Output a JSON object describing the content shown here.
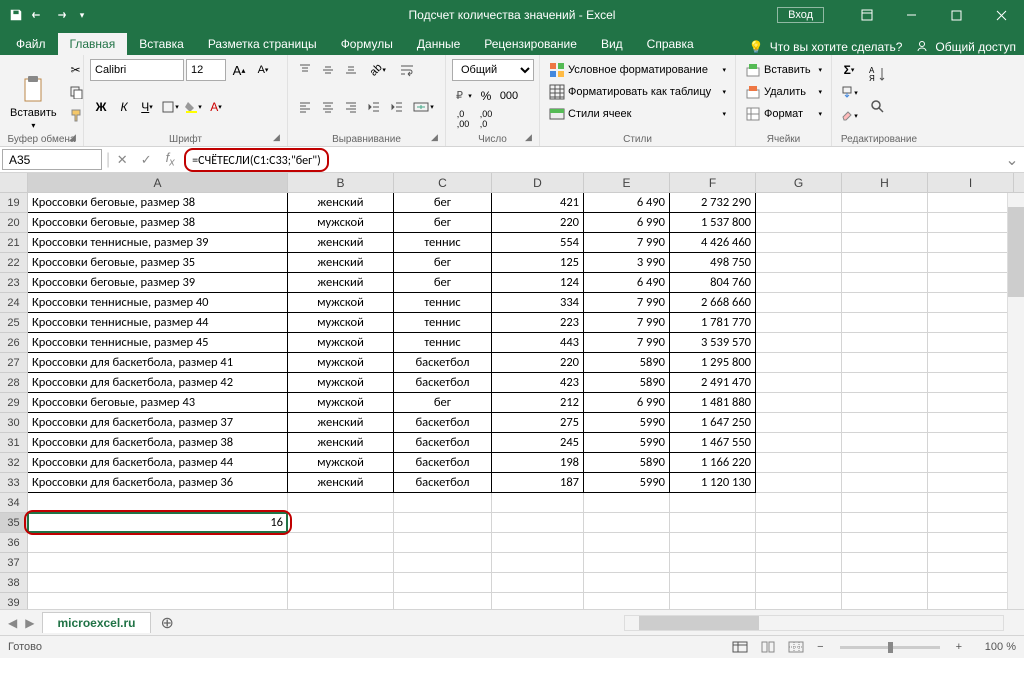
{
  "titlebar": {
    "title": "Подсчет количества значений - Excel",
    "signin": "Вход"
  },
  "tabs": {
    "file": "Файл",
    "home": "Главная",
    "insert": "Вставка",
    "pagelayout": "Разметка страницы",
    "formulas": "Формулы",
    "data": "Данные",
    "review": "Рецензирование",
    "view": "Вид",
    "help": "Справка",
    "tellme": "Что вы хотите сделать?",
    "share": "Общий доступ"
  },
  "ribbon": {
    "clipboard": {
      "label": "Буфер обмена",
      "paste": "Вставить"
    },
    "font": {
      "label": "Шрифт",
      "name": "Calibri",
      "size": "12"
    },
    "alignment": {
      "label": "Выравнивание"
    },
    "number": {
      "label": "Число",
      "format": "Общий"
    },
    "styles": {
      "label": "Стили",
      "cond": "Условное форматирование",
      "table": "Форматировать как таблицу",
      "cell": "Стили ячеек"
    },
    "cells": {
      "label": "Ячейки",
      "insert": "Вставить",
      "delete": "Удалить",
      "format": "Формат"
    },
    "editing": {
      "label": "Редактирование"
    }
  },
  "namebox": "A35",
  "formula": "=СЧЁТЕСЛИ(C1:C33;\"бег\")",
  "columns": [
    "A",
    "B",
    "C",
    "D",
    "E",
    "F",
    "G",
    "H",
    "I"
  ],
  "rows": [
    {
      "n": 19,
      "a": "Кроссовки беговые, размер 38",
      "b": "женский",
      "c": "бег",
      "d": "421",
      "e": "6 490",
      "f": "2 732 290"
    },
    {
      "n": 20,
      "a": "Кроссовки беговые, размер 38",
      "b": "мужской",
      "c": "бег",
      "d": "220",
      "e": "6 990",
      "f": "1 537 800"
    },
    {
      "n": 21,
      "a": "Кроссовки теннисные, размер 39",
      "b": "женский",
      "c": "теннис",
      "d": "554",
      "e": "7 990",
      "f": "4 426 460"
    },
    {
      "n": 22,
      "a": "Кроссовки беговые, размер 35",
      "b": "женский",
      "c": "бег",
      "d": "125",
      "e": "3 990",
      "f": "498 750"
    },
    {
      "n": 23,
      "a": "Кроссовки беговые, размер 39",
      "b": "женский",
      "c": "бег",
      "d": "124",
      "e": "6 490",
      "f": "804 760"
    },
    {
      "n": 24,
      "a": "Кроссовки теннисные, размер 40",
      "b": "мужской",
      "c": "теннис",
      "d": "334",
      "e": "7 990",
      "f": "2 668 660"
    },
    {
      "n": 25,
      "a": "Кроссовки теннисные, размер 44",
      "b": "мужской",
      "c": "теннис",
      "d": "223",
      "e": "7 990",
      "f": "1 781 770"
    },
    {
      "n": 26,
      "a": "Кроссовки теннисные, размер 45",
      "b": "мужской",
      "c": "теннис",
      "d": "443",
      "e": "7 990",
      "f": "3 539 570"
    },
    {
      "n": 27,
      "a": "Кроссовки для баскетбола, размер 41",
      "b": "мужской",
      "c": "баскетбол",
      "d": "220",
      "e": "5890",
      "f": "1 295 800"
    },
    {
      "n": 28,
      "a": "Кроссовки для баскетбола, размер 42",
      "b": "мужской",
      "c": "баскетбол",
      "d": "423",
      "e": "5890",
      "f": "2 491 470"
    },
    {
      "n": 29,
      "a": "Кроссовки беговые, размер 43",
      "b": "мужской",
      "c": "бег",
      "d": "212",
      "e": "6 990",
      "f": "1 481 880"
    },
    {
      "n": 30,
      "a": "Кроссовки для баскетбола, размер 37",
      "b": "женский",
      "c": "баскетбол",
      "d": "275",
      "e": "5990",
      "f": "1 647 250"
    },
    {
      "n": 31,
      "a": "Кроссовки для баскетбола, размер 38",
      "b": "женский",
      "c": "баскетбол",
      "d": "245",
      "e": "5990",
      "f": "1 467 550"
    },
    {
      "n": 32,
      "a": "Кроссовки для баскетбола, размер 44",
      "b": "мужской",
      "c": "баскетбол",
      "d": "198",
      "e": "5890",
      "f": "1 166 220"
    },
    {
      "n": 33,
      "a": "Кроссовки для баскетбола, размер 36",
      "b": "женский",
      "c": "баскетбол",
      "d": "187",
      "e": "5990",
      "f": "1 120 130"
    }
  ],
  "result_row": {
    "n": 35,
    "a": "16"
  },
  "empty_rows": [
    34,
    36,
    37,
    38,
    39
  ],
  "sheet": {
    "name": "microexcel.ru"
  },
  "status": {
    "ready": "Готово",
    "zoom": "100 %"
  }
}
